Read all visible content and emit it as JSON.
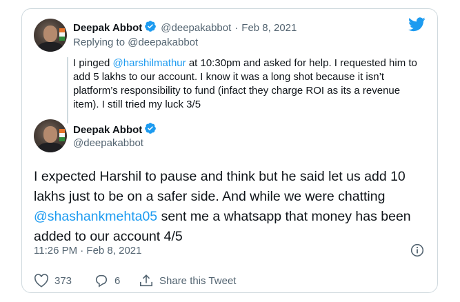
{
  "parent": {
    "name": "Deepak Abbot",
    "handle": "@deepakabbot",
    "separator": "·",
    "date": "Feb 8, 2021",
    "replying_prefix": "Replying to ",
    "replying_to": "@deepakabbot",
    "text_before": "I pinged ",
    "mention": "@harshilmathur",
    "text_after": " at 10:30pm and asked for help. I requested him to add 5 lakhs to our account. I know it was a long shot because it isn’t platform’s responsibility to fund (infact they charge ROI as its a revenue item). I still tried my luck 3/5"
  },
  "main": {
    "name": "Deepak Abbot",
    "handle": "@deepakabbot",
    "text_before": "I expected Harshil to pause and think but he said let us add 10 lakhs just to be on a safer side. And while we were chatting ",
    "mention": "@shashankmehta05",
    "text_after": " sent me a whatsapp that money has been added to our account 4/5",
    "timestamp": "11:26 PM · Feb 8, 2021"
  },
  "actions": {
    "likes": "373",
    "replies": "6",
    "share_label": "Share this Tweet"
  },
  "icons": [
    "twitter-logo-icon",
    "verified-badge-icon",
    "info-icon",
    "heart-icon",
    "reply-icon",
    "share-icon"
  ],
  "colors": {
    "accent": "#1d9bf0",
    "text": "#0f1419",
    "muted": "#536471",
    "border": "#cfd9de"
  }
}
